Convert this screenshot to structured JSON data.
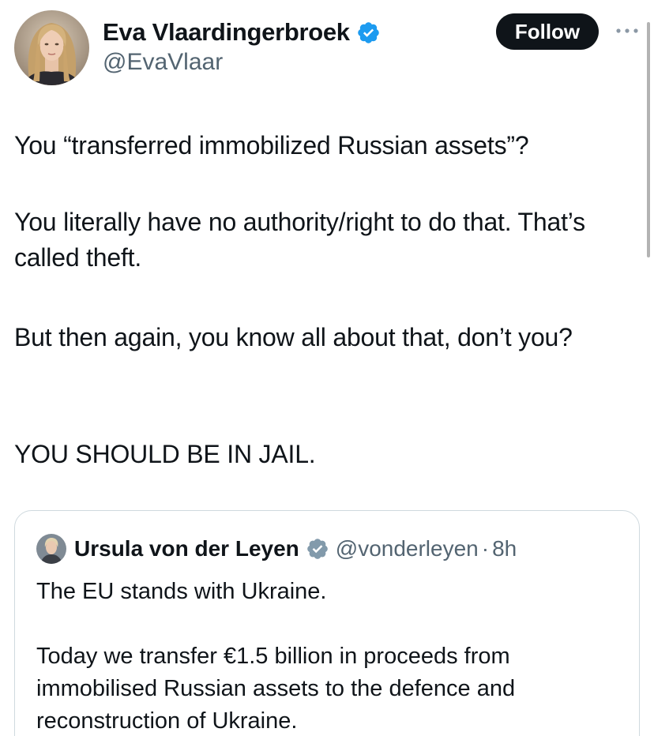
{
  "tweet": {
    "author": {
      "name": "Eva Vlaardingerbroek",
      "handle": "@EvaVlaar",
      "verified": true,
      "verified_color": "#1d9bf0"
    },
    "follow_label": "Follow",
    "more_icon": "more-horizontal-icon",
    "paragraphs": [
      "You “transferred immobilized Russian assets”?",
      "You literally have no authority/right to do that. That’s called theft.",
      "But then again, you know all about that, don’t you?",
      "YOU SHOULD BE IN JAIL."
    ]
  },
  "quoted_tweet": {
    "author": {
      "name": "Ursula von der Leyen",
      "handle": "@vonderleyen",
      "verified": true,
      "verified_color": "#829aab"
    },
    "separator": "·",
    "time": "8h",
    "paragraphs": [
      "The EU stands with Ukraine.",
      "Today we transfer €1.5 billion in proceeds from immobilised Russian assets to the defence and reconstruction of Ukraine."
    ]
  },
  "colors": {
    "text": "#0f1419",
    "secondary": "#536471",
    "follow_bg": "#0f1419",
    "border": "#cfd9de"
  }
}
